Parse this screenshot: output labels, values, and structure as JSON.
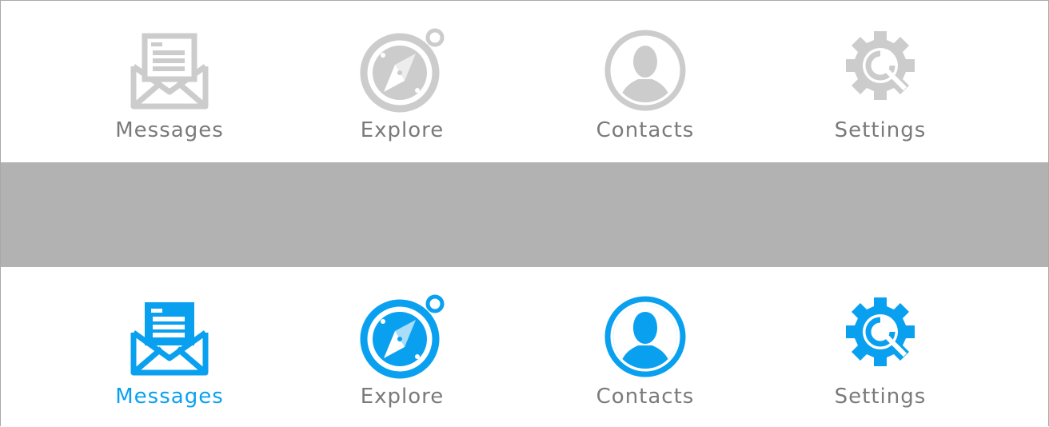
{
  "colors": {
    "inactive": "#cccccc",
    "active": "#0aa0f0",
    "label_inactive": "#7a7a7a",
    "separator": "#b2b2b2"
  },
  "tabbar_normal": {
    "tabs": [
      {
        "label": "Messages",
        "icon": "envelope-icon"
      },
      {
        "label": "Explore",
        "icon": "compass-icon"
      },
      {
        "label": "Contacts",
        "icon": "contact-icon"
      },
      {
        "label": "Settings",
        "icon": "gear-icon"
      }
    ]
  },
  "tabbar_selected": {
    "selected_tab": "Messages",
    "tabs": [
      {
        "label": "Messages",
        "icon": "envelope-icon"
      },
      {
        "label": "Explore",
        "icon": "compass-icon"
      },
      {
        "label": "Contacts",
        "icon": "contact-icon"
      },
      {
        "label": "Settings",
        "icon": "gear-icon"
      }
    ]
  }
}
